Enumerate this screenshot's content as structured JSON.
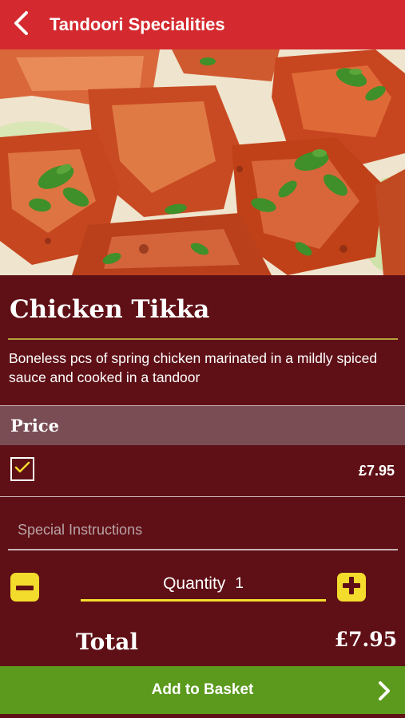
{
  "header": {
    "title": "Tandoori Specialities",
    "back_icon": "chevron-left-icon",
    "background": "#d42a2f"
  },
  "hero_image": {
    "subject": "chicken tikka pieces with coriander"
  },
  "dish": {
    "name": "Chicken Tikka",
    "description": "Boneless pcs of spring chicken marinated in a mildly spiced sauce and cooked in a tandoor"
  },
  "price_section": {
    "heading": "Price",
    "option_checked": true,
    "option_price": "£7.95"
  },
  "instructions": {
    "placeholder": "Special Instructions",
    "value": ""
  },
  "quantity": {
    "label": "Quantity",
    "value": "1",
    "minus_icon": "minus-icon",
    "plus_icon": "plus-icon"
  },
  "total": {
    "label": "Total",
    "value": "£7.95"
  },
  "add_button": {
    "label": "Add to Basket",
    "icon": "chevron-right-icon",
    "background": "#5b9a1d"
  },
  "colors": {
    "page_background": "#5f1016",
    "accent_yellow": "#f4dc2c",
    "price_header": "#7a4d55"
  }
}
